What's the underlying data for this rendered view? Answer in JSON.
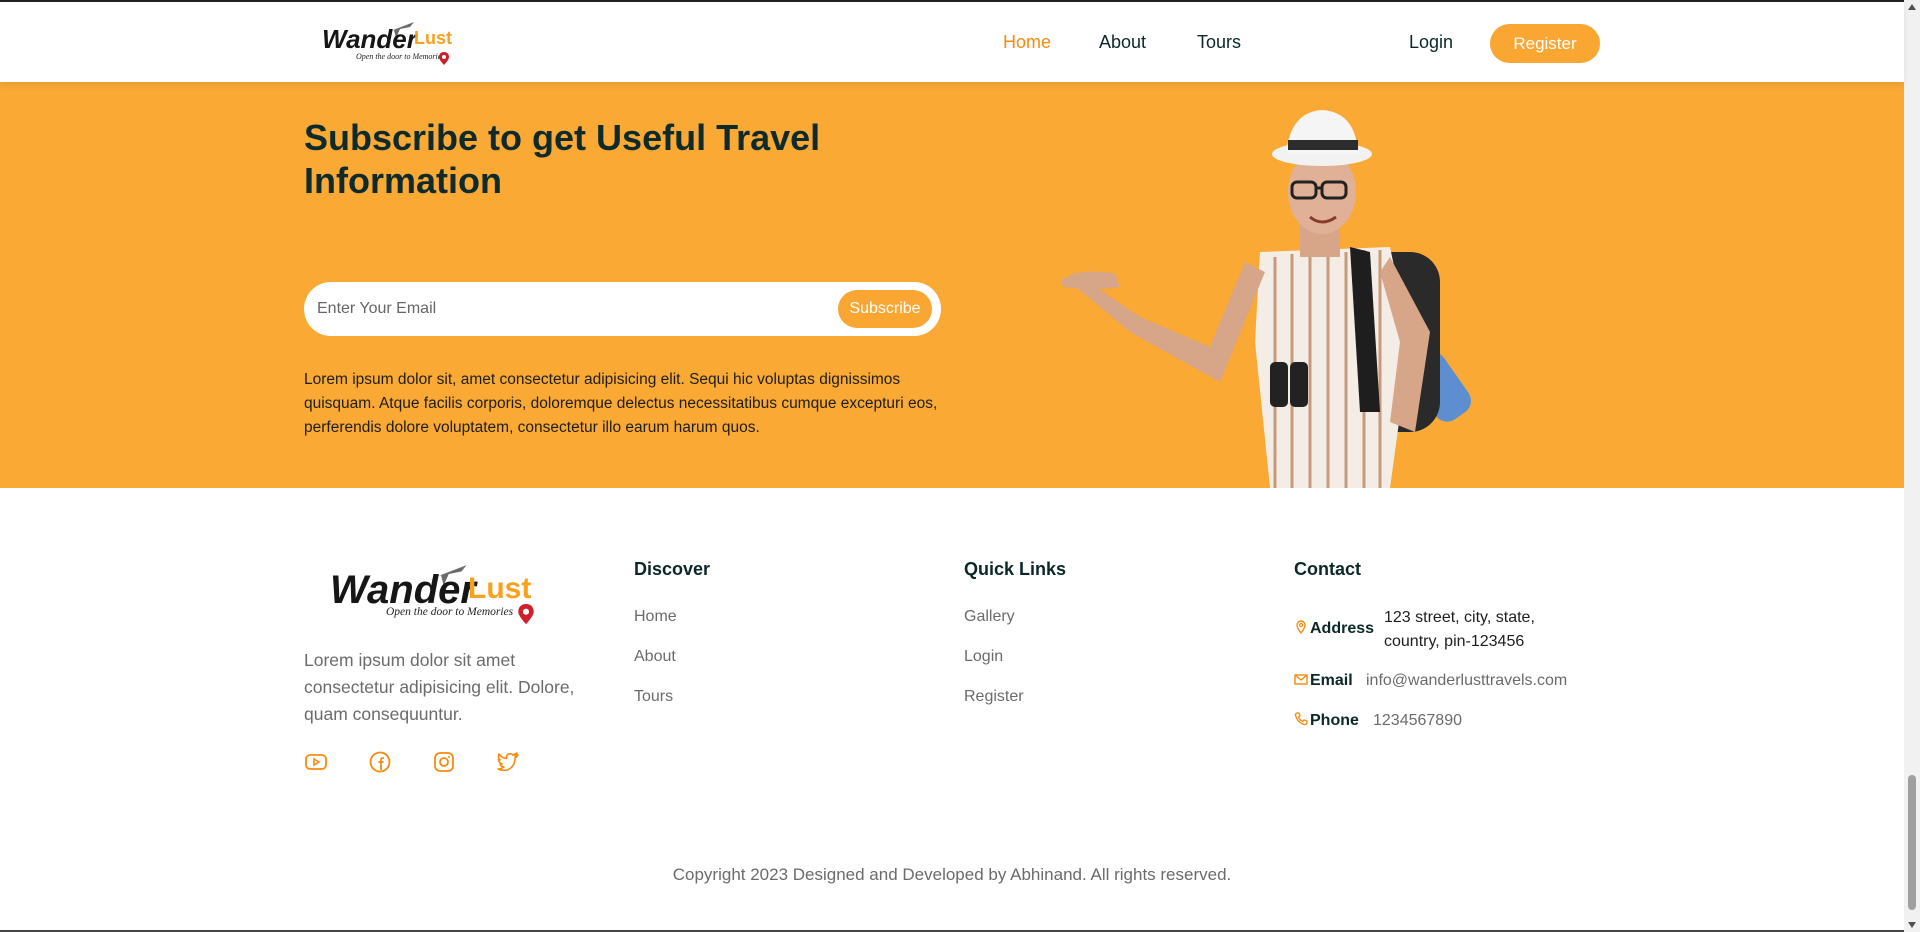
{
  "logo": {
    "word": "Wander",
    "accent": "Lust",
    "tagline": "Open the door to Memories"
  },
  "nav": {
    "items": [
      {
        "label": "Home",
        "active": true
      },
      {
        "label": "About",
        "active": false
      },
      {
        "label": "Tours",
        "active": false
      }
    ],
    "login_label": "Login",
    "register_label": "Register"
  },
  "hero": {
    "title": "Subscribe to get Useful Travel Information",
    "email_placeholder": "Enter Your Email",
    "subscribe_label": "Subscribe",
    "description": "Lorem ipsum dolor sit, amet consectetur adipisicing elit. Sequi hic voluptas dignissimos quisquam. Atque facilis corporis, doloremque delectus necessitatibus cumque excepturi eos, perferendis dolore voluptatem, consectetur illo earum harum quos."
  },
  "footer": {
    "description": "Lorem ipsum dolor sit amet consectetur adipisicing elit. Dolore, quam consequuntur.",
    "socials": [
      "youtube-icon",
      "facebook-icon",
      "instagram-icon",
      "twitter-icon"
    ],
    "discover": {
      "title": "Discover",
      "links": [
        "Home",
        "About",
        "Tours"
      ]
    },
    "quick_links": {
      "title": "Quick Links",
      "links": [
        "Gallery",
        "Login",
        "Register"
      ]
    },
    "contact": {
      "title": "Contact",
      "address_label": "Address",
      "address_value": "123 street, city, state, country, pin-123456",
      "email_label": "Email",
      "email_value": "info@wanderlusttravels.com",
      "phone_label": "Phone",
      "phone_value": "1234567890"
    },
    "copyright": "Copyright 2023 Designed and Developed by Abhinand. All rights reserved."
  },
  "colors": {
    "accent": "#f9a934",
    "accent_dark": "#f68b0e",
    "heading": "#0b2727",
    "muted": "#6b6b6b"
  }
}
